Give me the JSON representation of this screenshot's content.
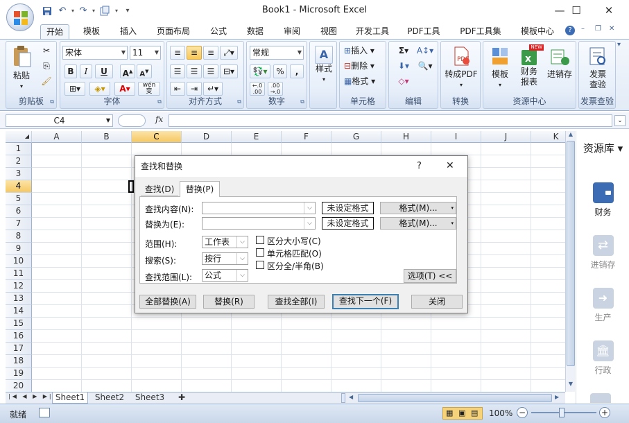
{
  "window": {
    "title": "Book1 - Microsoft Excel",
    "controls": {
      "minimize": "—",
      "maximize": "☐",
      "close": "✕"
    }
  },
  "quick_access": {
    "save_icon": "save-icon",
    "undo_icon": "undo-icon",
    "redo_icon": "redo-icon",
    "more": "▾"
  },
  "tabs": [
    "开始",
    "模板",
    "插入",
    "页面布局",
    "公式",
    "数据",
    "审阅",
    "视图",
    "开发工具",
    "PDF工具",
    "PDF工具集",
    "模板中心"
  ],
  "active_tab": "开始",
  "ribbon": {
    "clipboard": {
      "label": "剪贴板",
      "paste": "粘贴"
    },
    "font": {
      "label": "字体",
      "font_name": "宋体",
      "font_size": "11",
      "bold": "B",
      "italic": "I",
      "underline": "U",
      "grow": "A",
      "shrink": "A",
      "wen": "wén",
      "wen_char": "变"
    },
    "alignment": {
      "label": "对齐方式"
    },
    "number": {
      "label": "数字",
      "format": "常规",
      "percent": "%",
      "comma": ",",
      "inc_dec": "+.0\n.00",
      "dec_dec": ".00\n+.0"
    },
    "styles": {
      "label": "样式"
    },
    "cells": {
      "label": "单元格",
      "insert": "插入",
      "delete": "删除",
      "format": "格式"
    },
    "editing": {
      "label": "编辑",
      "sigma": "Σ"
    },
    "convert": {
      "label": "转换",
      "to_pdf": "转成PDF"
    },
    "resource_center": {
      "label": "资源中心",
      "template": "模板",
      "finance": "财务\n报表",
      "inventory": "进销存",
      "new_badge": "NEW"
    },
    "invoice": {
      "label": "发票查验",
      "check": "发票\n查验"
    }
  },
  "formula_bar": {
    "name_box": "C4",
    "fx": "fx",
    "value": ""
  },
  "grid": {
    "columns": [
      "A",
      "B",
      "C",
      "D",
      "E",
      "F",
      "G",
      "H",
      "I",
      "J",
      "K"
    ],
    "rows": [
      "1",
      "2",
      "3",
      "4",
      "5",
      "6",
      "7",
      "8",
      "9",
      "10",
      "11",
      "12",
      "13",
      "14",
      "15",
      "16",
      "17",
      "18",
      "19",
      "20"
    ],
    "selected_col": "C",
    "selected_row": "4"
  },
  "sheets": [
    "Sheet1",
    "Sheet2",
    "Sheet3"
  ],
  "active_sheet": "Sheet1",
  "status": {
    "ready": "就绪",
    "zoom": "100%",
    "minus": "−",
    "plus": "+"
  },
  "side_panel": {
    "title": "资源库",
    "items": [
      {
        "label": "财务",
        "icon": "wallet-icon",
        "active": true
      },
      {
        "label": "进销存",
        "icon": "swap-icon",
        "active": false
      },
      {
        "label": "生产",
        "icon": "arrow-right-icon",
        "active": false
      },
      {
        "label": "行政",
        "icon": "building-icon",
        "active": false
      }
    ]
  },
  "dialog": {
    "title": "查找和替换",
    "help": "?",
    "close": "✕",
    "tabs": [
      "查找(D)",
      "替换(P)"
    ],
    "active_tab": "替换(P)",
    "find_label": "查找内容(N):",
    "replace_label": "替换为(E):",
    "find_value": "",
    "replace_value": "",
    "no_format": "未设定格式",
    "format_button": "格式(M)...",
    "scope_label": "范围(H):",
    "scope_value": "工作表",
    "search_label": "搜索(S):",
    "search_value": "按行",
    "lookin_label": "查找范围(L):",
    "lookin_value": "公式",
    "match_case": "区分大小写(C)",
    "match_cell": "单元格匹配(O)",
    "match_width": "区分全/半角(B)",
    "options": "选项(T) <<",
    "replace_all": "全部替换(A)",
    "replace": "替换(R)",
    "find_all": "查找全部(I)",
    "find_next": "查找下一个(F)",
    "close_btn": "关闭"
  }
}
